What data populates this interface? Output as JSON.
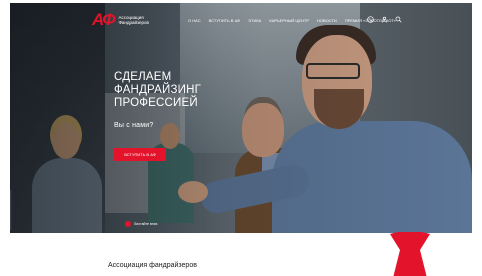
{
  "brand": {
    "logo_mark": "АФ",
    "logo_text": "Ассоциация Фандрайзеров",
    "accent_color": "#e2132b"
  },
  "nav": {
    "menu": [
      "О нас",
      "Вступить в АФ",
      "Этика",
      "Карьерный центр",
      "Новости",
      "Премия «Золотой кот»"
    ],
    "icons": [
      "phone-icon",
      "user-icon",
      "search-icon"
    ]
  },
  "hero": {
    "title_lines": [
      "Сделаем",
      "фандрайзинг",
      "профессией"
    ],
    "subtitle": "Вы с нами?",
    "cta_label": "Вступить в АФ",
    "scroll_label": "Листайте вниз"
  },
  "intro": {
    "heading": "Ассоциация фандрайзеров"
  }
}
